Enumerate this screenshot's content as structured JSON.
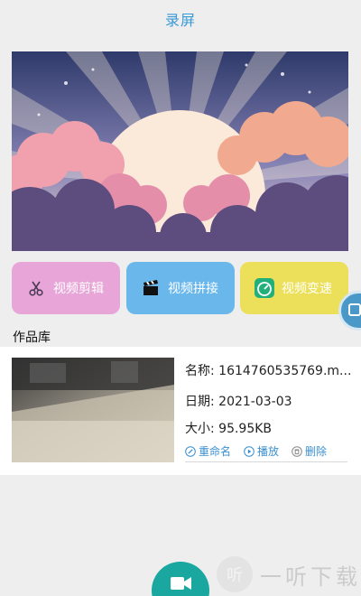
{
  "header": {
    "title": "录屏"
  },
  "tools": [
    {
      "label": "视频剪辑",
      "icon": "scissors-icon",
      "color": "#e8a6d8"
    },
    {
      "label": "视频拼接",
      "icon": "clapperboard-icon",
      "color": "#6ab7ec"
    },
    {
      "label": "视频变速",
      "icon": "speedometer-icon",
      "color": "#ece05a"
    }
  ],
  "library": {
    "title": "作品库",
    "items": [
      {
        "name": "名称: 1614760535769.m...",
        "date": "日期: 2021-03-03",
        "size": "大小:  95.95KB",
        "actions": {
          "rename": "重命名",
          "play": "播放",
          "delete": "删除"
        }
      }
    ]
  },
  "watermark": {
    "text": "一听下载",
    "badge": "听"
  },
  "colors": {
    "accent": "#3a9ad6",
    "fab": "#19a7a0"
  }
}
